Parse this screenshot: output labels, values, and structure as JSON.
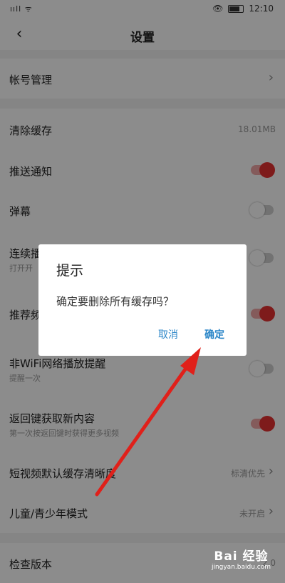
{
  "status_bar": {
    "signal_text": "ııll ᯤ",
    "time": "12:10"
  },
  "header": {
    "back_icon": "‹",
    "title": "设置"
  },
  "rows": {
    "account": {
      "label": "帐号管理",
      "chevron": "›"
    },
    "clear_cache": {
      "label": "清除缓存",
      "value": "18.01MB"
    },
    "push": {
      "label": "推送通知",
      "toggle": "on"
    },
    "danmaku": {
      "label": "弹幕",
      "toggle": "off"
    },
    "autoplay": {
      "label": "连续播",
      "sub": "打开开",
      "toggle": "off"
    },
    "recommend": {
      "label": "推荐频",
      "toggle": "on"
    },
    "non_wifi": {
      "label": "非WiFi网络播放提醒",
      "sub": "提醒一次",
      "toggle": "off"
    },
    "back_refresh": {
      "label": "返回键获取新内容",
      "sub": "第一次按返回键时获得更多视频",
      "toggle": "on"
    },
    "short_video": {
      "label": "短视频默认缓存清晰度",
      "value": "标清优先",
      "chevron": "›"
    },
    "kids_mode": {
      "label": "儿童/青少年模式",
      "value": "未开启",
      "chevron": "›"
    },
    "check_version": {
      "label": "检查版本",
      "value": "2.0"
    }
  },
  "dialog": {
    "title": "提示",
    "message": "确定要删除所有缓存吗？",
    "cancel": "取消",
    "confirm": "确定"
  },
  "watermark": {
    "brand": "Bai 经验",
    "url": "jingyan.baidu.com"
  },
  "colors": {
    "accent_blue": "#2b86c8",
    "toggle_red": "#e63232",
    "annotation_arrow": "#e0201a"
  }
}
